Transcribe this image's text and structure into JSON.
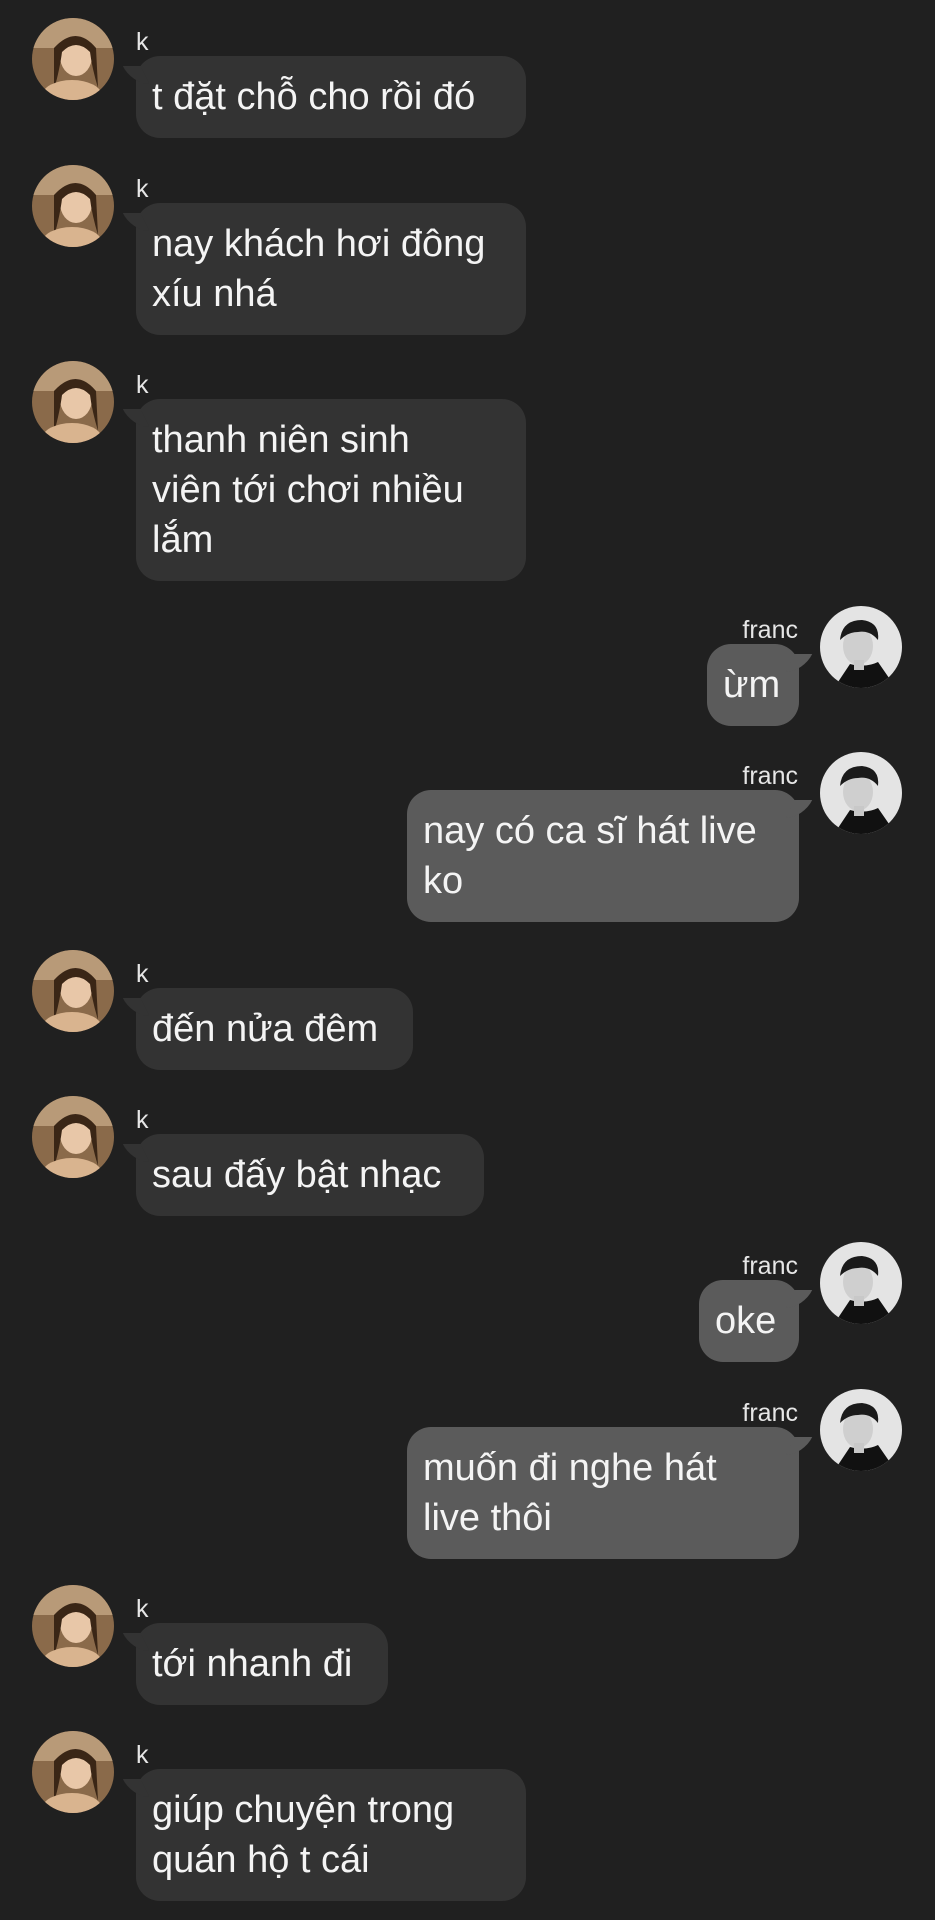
{
  "contacts": {
    "k": {
      "name": "k"
    },
    "franc": {
      "name": "franc"
    }
  },
  "messages": [
    {
      "from": "k",
      "direction": "incoming",
      "lines": [
        "t đặt chỗ cho rồi đó"
      ]
    },
    {
      "from": "k",
      "direction": "incoming",
      "lines": [
        "nay khách hơi đông",
        "xíu nhá"
      ]
    },
    {
      "from": "k",
      "direction": "incoming",
      "lines": [
        "thanh niên sinh",
        "viên tới chơi nhiều",
        "lắm"
      ]
    },
    {
      "from": "franc",
      "direction": "outgoing",
      "lines": [
        "ừm"
      ]
    },
    {
      "from": "franc",
      "direction": "outgoing",
      "lines": [
        "nay có ca sĩ hát live",
        "ko"
      ]
    },
    {
      "from": "k",
      "direction": "incoming",
      "lines": [
        "đến nửa đêm"
      ]
    },
    {
      "from": "k",
      "direction": "incoming",
      "lines": [
        "sau đấy bật nhạc"
      ]
    },
    {
      "from": "franc",
      "direction": "outgoing",
      "lines": [
        "oke"
      ]
    },
    {
      "from": "franc",
      "direction": "outgoing",
      "lines": [
        "muốn đi nghe hát",
        "live thôi"
      ]
    },
    {
      "from": "k",
      "direction": "incoming",
      "lines": [
        "tới nhanh đi"
      ]
    },
    {
      "from": "k",
      "direction": "incoming",
      "lines": [
        "giúp chuyện trong",
        "quán hộ t cái"
      ]
    }
  ],
  "theme": {
    "background": "#202020",
    "incoming_bubble": "#333333",
    "outgoing_bubble": "#5b5b5b",
    "text": "#f4f4f4"
  },
  "icons": {
    "k_avatar": "avatar-photo-k",
    "franc_avatar": "avatar-photo-franc"
  }
}
